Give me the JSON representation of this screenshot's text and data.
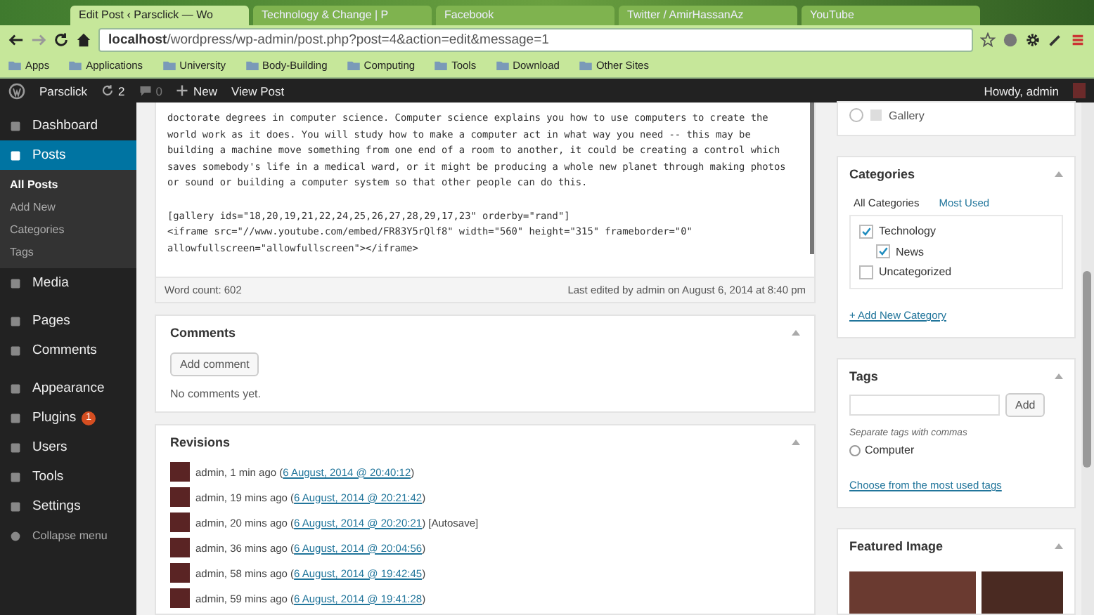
{
  "browser": {
    "tabs": [
      {
        "title": "Edit Post ‹ Parsclick — Wo",
        "selected": true
      },
      {
        "title": "Technology & Change | P",
        "selected": false
      },
      {
        "title": "Facebook",
        "selected": false
      },
      {
        "title": "Twitter / AmirHassanAz",
        "selected": false
      },
      {
        "title": "YouTube",
        "selected": false
      }
    ],
    "address": {
      "host": "localhost",
      "path": "/wordpress/wp-admin/post.php?post=4&action=edit&message=1"
    },
    "bookmarks": [
      "Apps",
      "Applications",
      "University",
      "Body-Building",
      "Computing",
      "Tools",
      "Download",
      "Other Sites"
    ]
  },
  "admin_bar": {
    "site": "Parsclick",
    "updates": "2",
    "comments": "0",
    "new": "New",
    "view": "View Post",
    "greeting": "Howdy, admin"
  },
  "sidebar": {
    "items": [
      {
        "label": "Dashboard",
        "selected": false
      },
      {
        "label": "Posts",
        "selected": true,
        "children": [
          {
            "label": "All Posts",
            "selected": true
          },
          {
            "label": "Add New",
            "selected": false
          },
          {
            "label": "Categories",
            "selected": false
          },
          {
            "label": "Tags",
            "selected": false
          }
        ]
      },
      {
        "label": "Media",
        "selected": false
      },
      {
        "label": "Pages",
        "selected": false
      },
      {
        "label": "Comments",
        "selected": false
      },
      {
        "label": "Appearance",
        "selected": false
      },
      {
        "label": "Plugins",
        "selected": false,
        "badge": "1"
      },
      {
        "label": "Users",
        "selected": false
      },
      {
        "label": "Tools",
        "selected": false
      },
      {
        "label": "Settings",
        "selected": false
      }
    ],
    "collapse": "Collapse menu"
  },
  "editor": {
    "paragraph": [
      "doctorate degrees in computer science. Computer science explains you how to use computers to create the",
      "world work as it does. You will study how to make a computer act in what way you need -- this may be",
      "building a machine move something from one end of a room to another, it could be creating a control which",
      "saves somebody's life in a medical ward, or it might be producing a whole new planet through making photos",
      "or sound or building a computer system so that other people can do this."
    ],
    "code": [
      "[gallery ids=\"18,20,19,21,22,24,25,26,27,28,29,17,23\" orderby=\"rand\"]",
      "<iframe src=\"//www.youtube.com/embed/FR83Y5rQlf8\" width=\"560\" height=\"315\" frameborder=\"0\"",
      "allowfullscreen=\"allowfullscreen\"></iframe>"
    ],
    "word_count": "Word count: 602",
    "last_edited": "Last edited by admin on August 6, 2014 at 8:40 pm"
  },
  "comments": {
    "title": "Comments",
    "button": "Add comment",
    "empty": "No comments yet."
  },
  "revisions": {
    "title": "Revisions",
    "items": [
      {
        "text": "admin, 1 min ago (",
        "link": "6 August, 2014 @ 20:40:12",
        "tail": ")"
      },
      {
        "text": "admin, 19 mins ago (",
        "link": "6 August, 2014 @ 20:21:42",
        "tail": ")"
      },
      {
        "text": "admin, 20 mins ago (",
        "link": "6 August, 2014 @ 20:20:21",
        "tail": ") [Autosave]"
      },
      {
        "text": "admin, 36 mins ago (",
        "link": "6 August, 2014 @ 20:04:56",
        "tail": ")"
      },
      {
        "text": "admin, 58 mins ago (",
        "link": "6 August, 2014 @ 19:42:45",
        "tail": ")"
      },
      {
        "text": "admin, 59 mins ago (",
        "link": "6 August, 2014 @ 19:41:28",
        "tail": ")"
      }
    ]
  },
  "format": {
    "label": "Gallery",
    "selected": false
  },
  "categories": {
    "title": "Categories",
    "tabs": [
      {
        "label": "All Categories",
        "selected": true
      },
      {
        "label": "Most Used",
        "selected": false
      }
    ],
    "items": [
      {
        "label": "Technology",
        "checked": true,
        "children": [
          {
            "label": "News",
            "checked": true
          }
        ]
      },
      {
        "label": "Uncategorized",
        "checked": false
      }
    ],
    "add_link": "+ Add New Category"
  },
  "tags": {
    "title": "Tags",
    "button": "Add",
    "hint": "Separate tags with commas",
    "items": [
      "Computer"
    ],
    "choose_link": "Choose from the most used tags"
  },
  "featured": {
    "title": "Featured Image"
  }
}
